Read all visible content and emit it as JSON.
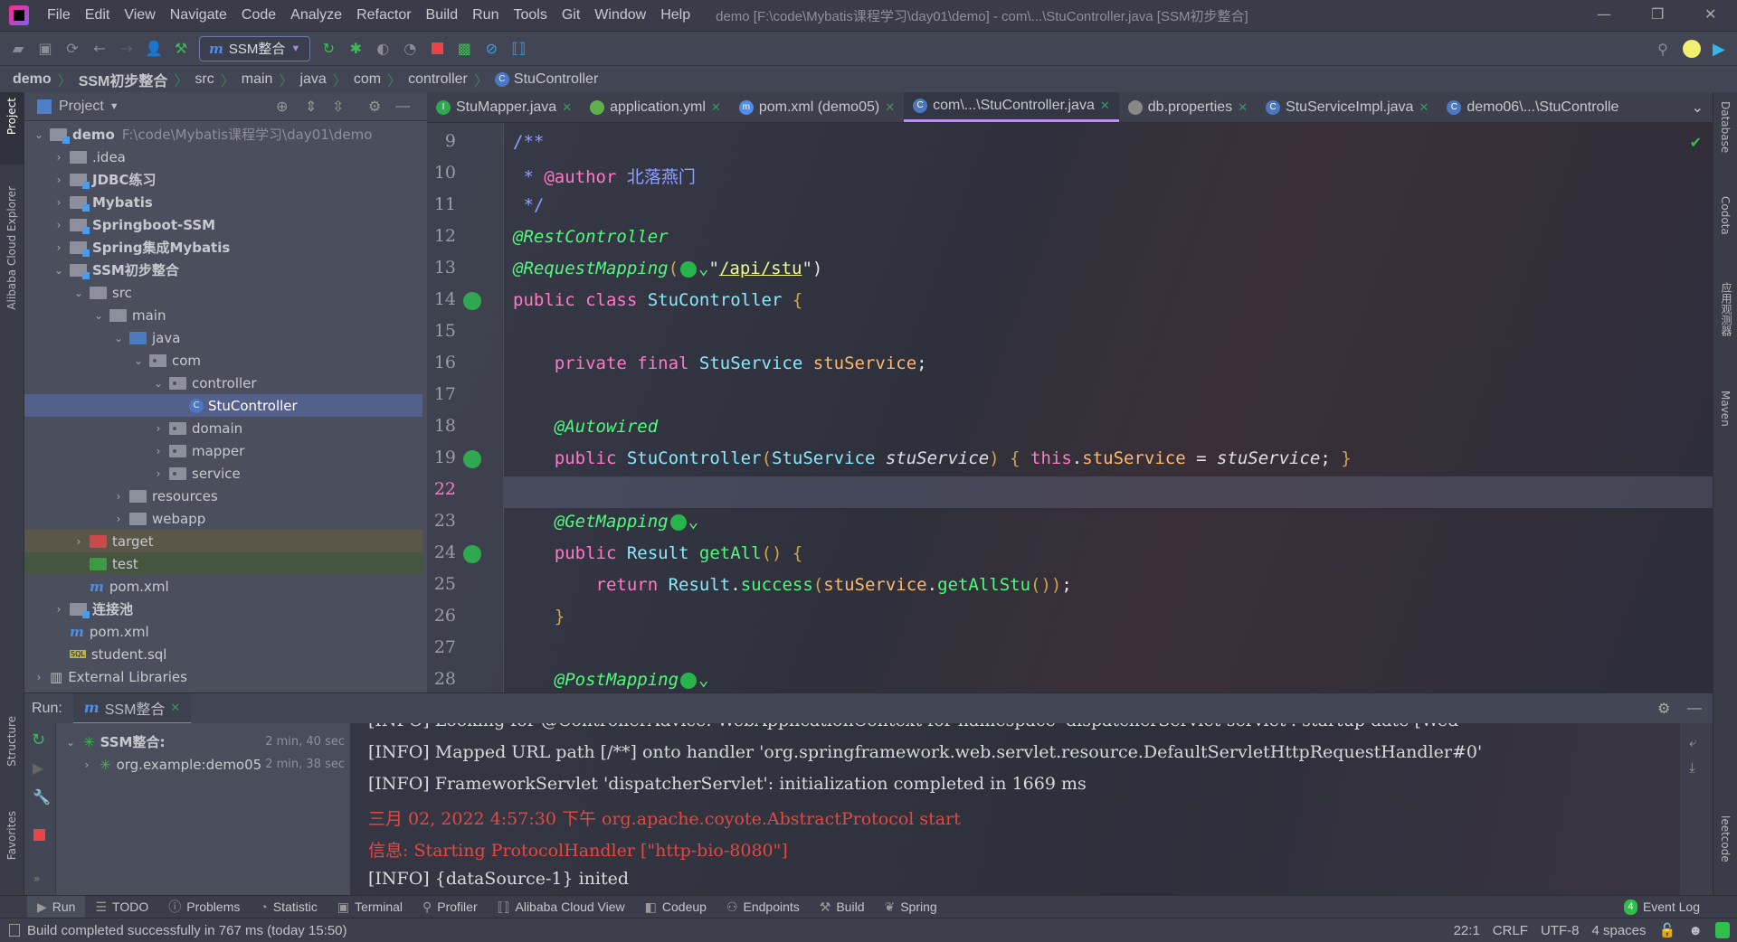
{
  "menubar": {
    "items": [
      "File",
      "Edit",
      "View",
      "Navigate",
      "Code",
      "Analyze",
      "Refactor",
      "Build",
      "Run",
      "Tools",
      "Git",
      "Window",
      "Help"
    ],
    "title": "demo [F:\\code\\Mybatis课程学习\\day01\\demo] - com\\...\\StuController.java [SSM初步整合]"
  },
  "toolbar": {
    "run_config": "SSM整合"
  },
  "breadcrumb": [
    "demo",
    "SSM初步整合",
    "src",
    "main",
    "java",
    "com",
    "controller",
    "StuController"
  ],
  "left_strip": {
    "project": "Project",
    "cloud": "Alibaba Cloud Explorer",
    "structure": "Structure",
    "favorites": "Favorites"
  },
  "right_strip": {
    "database": "Database",
    "codota": "Codota",
    "observer": "应用观测器",
    "maven": "Maven",
    "leetcode": "leetcode"
  },
  "project_panel": {
    "title": "Project",
    "tree": [
      {
        "label": "demo",
        "path": "F:\\code\\Mybatis课程学习\\day01\\demo",
        "depth": 0,
        "arrow": "down",
        "icon": "module",
        "bold": true
      },
      {
        "label": ".idea",
        "depth": 1,
        "arrow": "right",
        "icon": "folder"
      },
      {
        "label": "JDBC练习",
        "depth": 1,
        "arrow": "right",
        "icon": "module",
        "bold": true
      },
      {
        "label": "Mybatis",
        "depth": 1,
        "arrow": "right",
        "icon": "module",
        "bold": true
      },
      {
        "label": "Springboot-SSM",
        "depth": 1,
        "arrow": "right",
        "icon": "module",
        "bold": true
      },
      {
        "label": "Spring集成Mybatis",
        "depth": 1,
        "arrow": "right",
        "icon": "module",
        "bold": true
      },
      {
        "label": "SSM初步整合",
        "depth": 1,
        "arrow": "down",
        "icon": "module",
        "bold": true
      },
      {
        "label": "src",
        "depth": 2,
        "arrow": "down",
        "icon": "folder"
      },
      {
        "label": "main",
        "depth": 3,
        "arrow": "down",
        "icon": "folder"
      },
      {
        "label": "java",
        "depth": 4,
        "arrow": "down",
        "icon": "source"
      },
      {
        "label": "com",
        "depth": 5,
        "arrow": "down",
        "icon": "package"
      },
      {
        "label": "controller",
        "depth": 6,
        "arrow": "down",
        "icon": "package"
      },
      {
        "label": "StuController",
        "depth": 7,
        "arrow": "",
        "icon": "class",
        "selected": true
      },
      {
        "label": "domain",
        "depth": 6,
        "arrow": "right",
        "icon": "package"
      },
      {
        "label": "mapper",
        "depth": 6,
        "arrow": "right",
        "icon": "package"
      },
      {
        "label": "service",
        "depth": 6,
        "arrow": "right",
        "icon": "package"
      },
      {
        "label": "resources",
        "depth": 4,
        "arrow": "right",
        "icon": "folder"
      },
      {
        "label": "webapp",
        "depth": 4,
        "arrow": "right",
        "icon": "folder"
      },
      {
        "label": "target",
        "depth": 2,
        "arrow": "right",
        "icon": "excluded",
        "row": "excluded"
      },
      {
        "label": "test",
        "depth": 2,
        "arrow": "",
        "icon": "test",
        "row": "test"
      },
      {
        "label": "pom.xml",
        "depth": 2,
        "arrow": "",
        "icon": "maven"
      },
      {
        "label": "连接池",
        "depth": 1,
        "arrow": "right",
        "icon": "module",
        "bold": true
      },
      {
        "label": "pom.xml",
        "depth": 1,
        "arrow": "",
        "icon": "maven"
      },
      {
        "label": "student.sql",
        "depth": 1,
        "arrow": "",
        "icon": "sql"
      },
      {
        "label": "External Libraries",
        "depth": 0,
        "arrow": "right",
        "icon": "library"
      }
    ]
  },
  "editor_tabs": [
    {
      "label": "StuMapper.java",
      "icon": "interface",
      "color": "#2fa84f"
    },
    {
      "label": "application.yml",
      "icon": "spring",
      "color": "#5fb04a"
    },
    {
      "label": "pom.xml (demo05)",
      "icon": "maven",
      "color": "#4f8ee8"
    },
    {
      "label": "com\\...\\StuController.java",
      "icon": "class",
      "color": "#4a78c2",
      "active": true
    },
    {
      "label": "db.properties",
      "icon": "properties",
      "color": "#888"
    },
    {
      "label": "StuServiceImpl.java",
      "icon": "class",
      "color": "#4a78c2"
    },
    {
      "label": "demo06\\...\\StuControlle",
      "icon": "class",
      "color": "#4a78c2"
    }
  ],
  "editor": {
    "current_line": "22",
    "lines": [
      {
        "n": "9",
        "tokens": [
          [
            "/**",
            "cm"
          ]
        ]
      },
      {
        "n": "10",
        "tokens": [
          [
            " * ",
            "cm"
          ],
          [
            "@author",
            "cmt"
          ],
          [
            " 北落燕门",
            "cm"
          ]
        ]
      },
      {
        "n": "11",
        "tokens": [
          [
            " */",
            "cm"
          ]
        ]
      },
      {
        "n": "12",
        "tokens": [
          [
            "@RestController",
            "an"
          ]
        ]
      },
      {
        "n": "13",
        "tokens": [
          [
            "@RequestMapping",
            "an"
          ],
          [
            "(",
            "br"
          ],
          [
            "GLOBE",
            "g"
          ],
          [
            "\"",
            "pl"
          ],
          [
            "/api/stu",
            "st"
          ],
          [
            "\")",
            "pl"
          ]
        ]
      },
      {
        "n": "14",
        "gicon": true,
        "tokens": [
          [
            "public ",
            "k"
          ],
          [
            "class ",
            "k"
          ],
          [
            "StuController ",
            "ty"
          ],
          [
            "{",
            "br"
          ]
        ]
      },
      {
        "n": "15",
        "tokens": []
      },
      {
        "n": "16",
        "tokens": [
          [
            "    private ",
            "k"
          ],
          [
            "final ",
            "k"
          ],
          [
            "StuService ",
            "ty"
          ],
          [
            "stuService",
            "fl"
          ],
          [
            ";",
            "pl"
          ]
        ]
      },
      {
        "n": "17",
        "tokens": []
      },
      {
        "n": "18",
        "tokens": [
          [
            "    @Autowired",
            "an"
          ]
        ]
      },
      {
        "n": "19",
        "gicon": true,
        "tokens": [
          [
            "    public ",
            "k"
          ],
          [
            "StuController",
            "ty"
          ],
          [
            "(",
            "br"
          ],
          [
            "StuService ",
            "ty"
          ],
          [
            "stuService",
            "pa"
          ],
          [
            ") ",
            "br"
          ],
          [
            "{ ",
            "br"
          ],
          [
            "this",
            "k"
          ],
          [
            ".",
            "pl"
          ],
          [
            "stuService",
            "fl"
          ],
          [
            " = ",
            "pl"
          ],
          [
            "stuService",
            "pa"
          ],
          [
            "; ",
            "pl"
          ],
          [
            "}",
            "br"
          ]
        ]
      },
      {
        "n": "22",
        "tokens": []
      },
      {
        "n": "23",
        "tokens": [
          [
            "    @GetMapping",
            "an"
          ],
          [
            "GLOBE",
            "g"
          ]
        ]
      },
      {
        "n": "24",
        "gicon": true,
        "tokens": [
          [
            "    public ",
            "k"
          ],
          [
            "Result ",
            "ty"
          ],
          [
            "getAll",
            "mt"
          ],
          [
            "() ",
            "br"
          ],
          [
            "{",
            "br"
          ]
        ]
      },
      {
        "n": "25",
        "tokens": [
          [
            "        return ",
            "k"
          ],
          [
            "Result",
            "ty"
          ],
          [
            ".",
            "pl"
          ],
          [
            "success",
            "mt"
          ],
          [
            "(",
            "br"
          ],
          [
            "stuService",
            "fl"
          ],
          [
            ".",
            "pl"
          ],
          [
            "getAllStu",
            "mt"
          ],
          [
            "())",
            "br"
          ],
          [
            ";",
            "pl"
          ]
        ]
      },
      {
        "n": "26",
        "tokens": [
          [
            "    }",
            "br"
          ]
        ]
      },
      {
        "n": "27",
        "tokens": []
      },
      {
        "n": "28",
        "tokens": [
          [
            "    @PostMapping",
            "an"
          ],
          [
            "GLOBE",
            "g"
          ]
        ]
      }
    ]
  },
  "run_panel": {
    "label": "Run:",
    "tab": "SSM整合",
    "tree": [
      {
        "label": "SSM整合:",
        "time": "2 min, 40 sec",
        "bold": true
      },
      {
        "label": "org.example:demo05",
        "time": "2 min, 38 sec"
      }
    ],
    "console": [
      {
        "text": "[INFO] Looking for @ControllerAdvice: WebApplicationContext for namespace 'dispatcherServlet-servlet': startup date [Wed",
        "type": "info"
      },
      {
        "text": "[INFO] Mapped URL path [/**] onto handler 'org.springframework.web.servlet.resource.DefaultServletHttpRequestHandler#0'",
        "type": "info"
      },
      {
        "text": "[INFO] FrameworkServlet 'dispatcherServlet': initialization completed in 1669 ms",
        "type": "info"
      },
      {
        "text": "三月 02, 2022 4:57:30 下午 org.apache.coyote.AbstractProtocol start",
        "type": "err"
      },
      {
        "text": "信息: Starting ProtocolHandler [\"http-bio-8080\"]",
        "type": "err"
      },
      {
        "text": "[INFO] {dataSource-1} inited",
        "type": "info"
      }
    ]
  },
  "bottom_tabs": [
    "Run",
    "TODO",
    "Problems",
    "Statistic",
    "Terminal",
    "Profiler",
    "Alibaba Cloud View",
    "Codeup",
    "Endpoints",
    "Build",
    "Spring"
  ],
  "event_log": {
    "count": "4",
    "label": "Event Log"
  },
  "status": {
    "message": "Build completed successfully in 767 ms (today 15:50)",
    "position": "22:1",
    "line_ending": "CRLF",
    "encoding": "UTF-8",
    "indent": "4 spaces"
  }
}
